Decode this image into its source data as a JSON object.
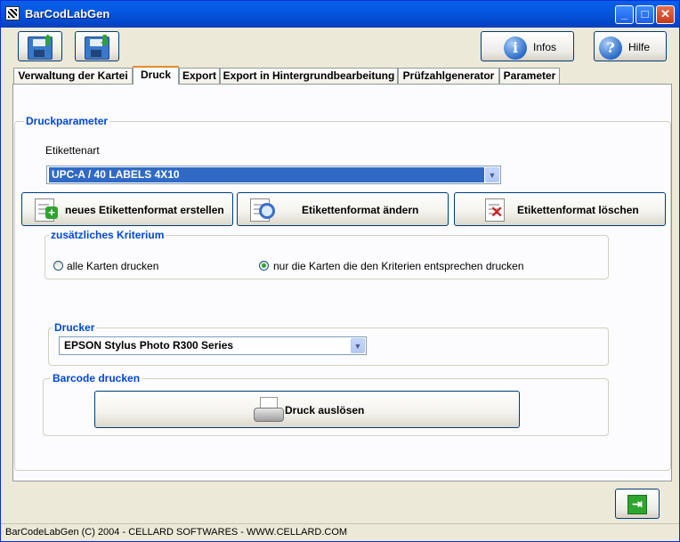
{
  "window": {
    "title": "BarCodLabGen"
  },
  "toolbar": {
    "infos_label": "Infos",
    "hilfe_label": "Hilfe"
  },
  "tabs": [
    {
      "label": "Verwaltung der Kartei"
    },
    {
      "label": "Druck"
    },
    {
      "label": "Export"
    },
    {
      "label": "Export in Hintergrundbearbeitung"
    },
    {
      "label": "Prüfzahlgenerator"
    },
    {
      "label": "Parameter"
    }
  ],
  "druckparameter": {
    "legend": "Druckparameter",
    "etikettenart_label": "Etikettenart",
    "etikettenart_value": "UPC-A / 40 LABELS 4X10",
    "btn_new": "neues Etikettenformat erstellen",
    "btn_edit": "Etikettenformat ändern",
    "btn_delete": "Etikettenformat löschen"
  },
  "kriterium": {
    "legend": "zusätzliches Kriterium",
    "option_all": "alle Karten drucken",
    "option_criteria": "nur die Karten die den Kriterien entsprechen drucken",
    "selected": "option_criteria"
  },
  "drucker": {
    "legend": "Drucker",
    "value": "EPSON Stylus Photo R300 Series"
  },
  "barcode": {
    "legend": "Barcode drucken",
    "print_button": "Druck auslösen"
  },
  "status": {
    "text": "BarCodeLabGen (C) 2004 - CELLARD SOFTWARES - WWW.CELLARD.COM"
  }
}
